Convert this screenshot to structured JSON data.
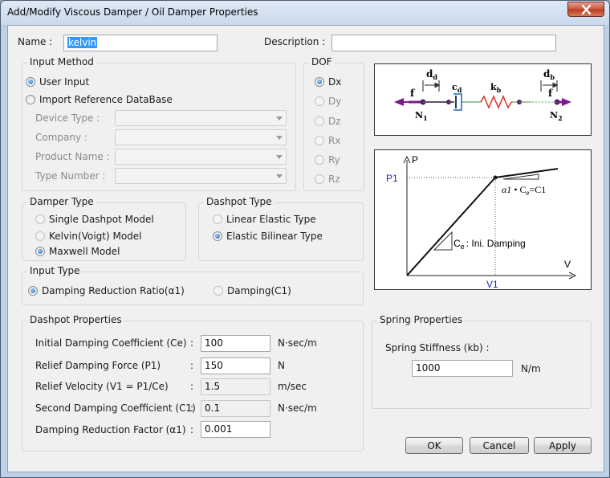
{
  "window": {
    "title": "Add/Modify Viscous Damper / Oil Damper Properties"
  },
  "name": {
    "label": "Name :",
    "value": "kelvin"
  },
  "description": {
    "label": "Description :",
    "value": ""
  },
  "input_method": {
    "title": "Input Method",
    "options": [
      "User Input",
      "Import Reference DataBase"
    ],
    "selected": "User Input",
    "fields": [
      {
        "label": "Device Type :",
        "value": ""
      },
      {
        "label": "Company :",
        "value": ""
      },
      {
        "label": "Product Name :",
        "value": ""
      },
      {
        "label": "Type Number :",
        "value": ""
      }
    ]
  },
  "dof": {
    "title": "DOF",
    "options": [
      "Dx",
      "Dy",
      "Dz",
      "Rx",
      "Ry",
      "Rz"
    ],
    "selected": "Dx"
  },
  "damper_type": {
    "title": "Damper Type",
    "options": [
      "Single Dashpot Model",
      "Kelvin(Voigt) Model",
      "Maxwell Model"
    ],
    "selected": "Maxwell Model"
  },
  "dashpot_type": {
    "title": "Dashpot Type",
    "options": [
      "Linear Elastic Type",
      "Elastic Bilinear Type"
    ],
    "selected": "Elastic Bilinear Type"
  },
  "input_type": {
    "title": "Input Type",
    "options": [
      "Damping Reduction Ratio(α1)",
      "Damping(C1)"
    ],
    "selected": "Damping Reduction Ratio(α1)"
  },
  "dashpot_properties": {
    "title": "Dashpot Properties",
    "rows": [
      {
        "label": "Initial Damping Coefficient (Ce)",
        "value": "100",
        "unit": "N·sec/m",
        "editable": true
      },
      {
        "label": "Relief Damping Force (P1)",
        "value": "150",
        "unit": "N",
        "editable": true
      },
      {
        "label": "Relief Velocity (V1 = P1/Ce)",
        "value": "1.5",
        "unit": "m/sec",
        "editable": false
      },
      {
        "label": "Second Damping Coefficient (C1)",
        "value": "0.1",
        "unit": "N·sec/m",
        "editable": false
      },
      {
        "label": "Damping Reduction Factor (α1)",
        "value": "0.001",
        "unit": "",
        "editable": true
      }
    ],
    "colon": ":"
  },
  "spring_properties": {
    "title": "Spring Properties",
    "label": "Spring Stiffness (kb) :",
    "value": "1000",
    "unit": "N/m"
  },
  "schematic": {
    "f_left": "f",
    "f_right": "f",
    "dd": "d",
    "dd_sub": "d",
    "cd": "c",
    "cd_sub": "d",
    "kb": "k",
    "kb_sub": "b",
    "db": "d",
    "db_sub": "b",
    "n1": "N",
    "n1_sub": "1",
    "n2": "N",
    "n2_sub": "2"
  },
  "graph": {
    "y_axis": "P",
    "x_axis": "V",
    "p1": "P1",
    "v1": "V1",
    "slope_label_pre": "α1",
    "slope_label_mid": "C",
    "slope_label_sub": "e",
    "slope_label_post": "=C1",
    "init_c": "C",
    "init_sub": "e",
    "init_text": ": Ini.  Damping",
    "accent": "#1f1fd0"
  },
  "buttons": {
    "ok": "OK",
    "cancel": "Cancel",
    "apply": "Apply"
  }
}
